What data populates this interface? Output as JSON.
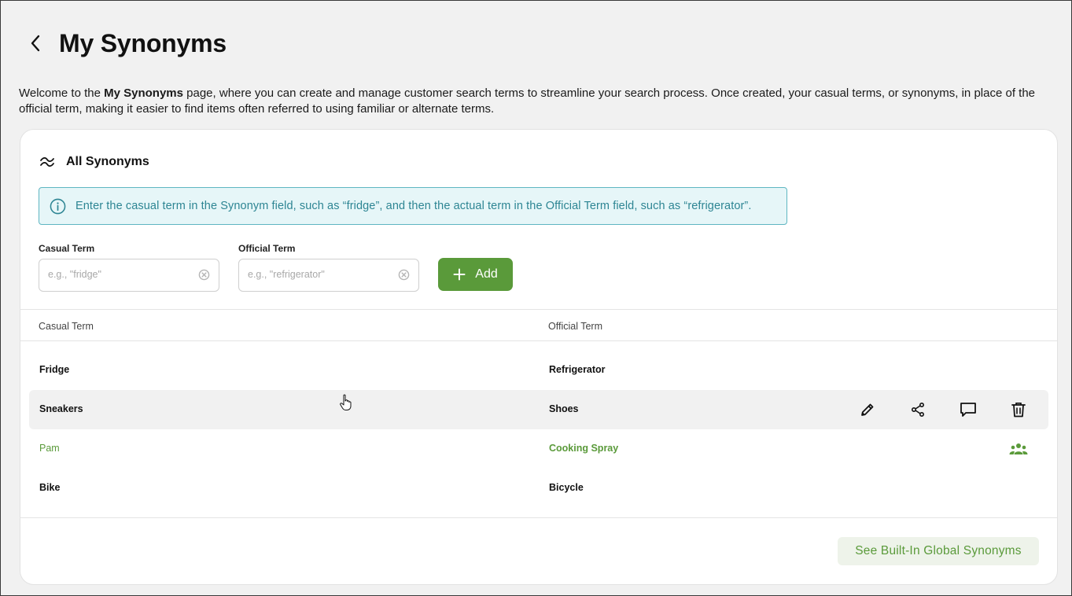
{
  "header": {
    "title": "My Synonyms",
    "back_icon": "chevron-left-icon"
  },
  "intro": {
    "prefix": "Welcome to the ",
    "bold": "My Synonyms",
    "suffix": " page, where you can create and manage customer search terms to streamline your search process. Once created, your casual terms, or synonyms, in place of the official term, making it easier to find items often referred to using familiar or alternate terms."
  },
  "card": {
    "title": "All Synonyms",
    "title_icon": "approx-icon",
    "info": "Enter the casual term in the Synonym field, such as “fridge”, and then the actual term in the Official Term field, such as “refrigerator”.",
    "casual_field": {
      "label": "Casual Term",
      "placeholder": "e.g., \"fridge\"",
      "value": ""
    },
    "official_field": {
      "label": "Official Term",
      "placeholder": "e.g., \"refrigerator\"",
      "value": ""
    },
    "add_label": "Add",
    "columns": {
      "casual": "Casual Term",
      "official": "Official Term"
    },
    "rows": [
      {
        "casual": "Fridge",
        "official": "Refrigerator"
      },
      {
        "casual": "Sneakers",
        "official": "Shoes"
      },
      {
        "casual": "Pam",
        "official": "Cooking Spray"
      },
      {
        "casual": "Bike",
        "official": "Bicycle"
      }
    ],
    "global_button": "See Built-In Global Synonyms"
  },
  "colors": {
    "accent_green": "#5a9a3a",
    "info_teal": "#2d8593",
    "info_bg": "#e6f6f8"
  }
}
